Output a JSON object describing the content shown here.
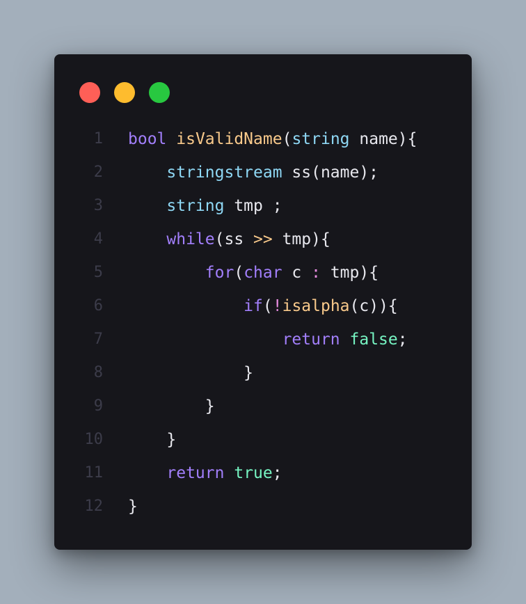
{
  "window": {
    "controls": [
      "close",
      "minimize",
      "maximize"
    ],
    "colors": {
      "close": "#ff5f57",
      "minimize": "#febc2e",
      "maximize": "#28c840",
      "background": "#16161b"
    }
  },
  "code": {
    "language": "cpp",
    "lines": [
      {
        "n": "1",
        "indent": "",
        "tokens": [
          {
            "t": "bool",
            "c": "kw"
          },
          {
            "t": " ",
            "c": "pu"
          },
          {
            "t": "isValidName",
            "c": "fn"
          },
          {
            "t": "(",
            "c": "pu"
          },
          {
            "t": "string",
            "c": "ty"
          },
          {
            "t": " name){",
            "c": "id"
          }
        ]
      },
      {
        "n": "2",
        "indent": "    ",
        "tokens": [
          {
            "t": "stringstream",
            "c": "ty"
          },
          {
            "t": " ss(name);",
            "c": "id"
          }
        ]
      },
      {
        "n": "3",
        "indent": "    ",
        "tokens": [
          {
            "t": "string",
            "c": "ty"
          },
          {
            "t": " tmp ;",
            "c": "id"
          }
        ]
      },
      {
        "n": "4",
        "indent": "    ",
        "tokens": [
          {
            "t": "while",
            "c": "kw"
          },
          {
            "t": "(ss ",
            "c": "id"
          },
          {
            "t": ">>",
            "c": "op"
          },
          {
            "t": " tmp){",
            "c": "id"
          }
        ]
      },
      {
        "n": "5",
        "indent": "        ",
        "tokens": [
          {
            "t": "for",
            "c": "kw"
          },
          {
            "t": "(",
            "c": "pu"
          },
          {
            "t": "char",
            "c": "kw"
          },
          {
            "t": " c ",
            "c": "id"
          },
          {
            "t": ":",
            "c": "neg"
          },
          {
            "t": " tmp){",
            "c": "id"
          }
        ]
      },
      {
        "n": "6",
        "indent": "            ",
        "tokens": [
          {
            "t": "if",
            "c": "kw"
          },
          {
            "t": "(",
            "c": "pu"
          },
          {
            "t": "!",
            "c": "neg"
          },
          {
            "t": "isalpha",
            "c": "fn"
          },
          {
            "t": "(c)){",
            "c": "id"
          }
        ]
      },
      {
        "n": "7",
        "indent": "                ",
        "tokens": [
          {
            "t": "return",
            "c": "kw"
          },
          {
            "t": " ",
            "c": "pu"
          },
          {
            "t": "false",
            "c": "lit"
          },
          {
            "t": ";",
            "c": "pu"
          }
        ]
      },
      {
        "n": "8",
        "indent": "            ",
        "tokens": [
          {
            "t": "}",
            "c": "pu"
          }
        ]
      },
      {
        "n": "9",
        "indent": "        ",
        "tokens": [
          {
            "t": "}",
            "c": "pu"
          }
        ]
      },
      {
        "n": "10",
        "indent": "    ",
        "tokens": [
          {
            "t": "}",
            "c": "pu"
          }
        ]
      },
      {
        "n": "11",
        "indent": "    ",
        "tokens": [
          {
            "t": "return",
            "c": "kw"
          },
          {
            "t": " ",
            "c": "pu"
          },
          {
            "t": "true",
            "c": "lit"
          },
          {
            "t": ";",
            "c": "pu"
          }
        ]
      },
      {
        "n": "12",
        "indent": "",
        "tokens": [
          {
            "t": "}",
            "c": "pu"
          }
        ]
      }
    ]
  }
}
